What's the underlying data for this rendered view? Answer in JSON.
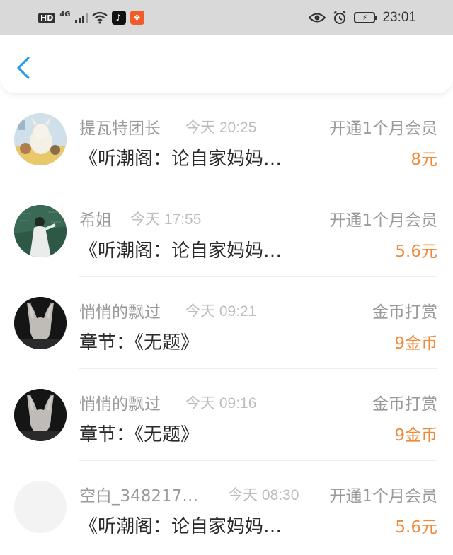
{
  "status_bar": {
    "hd": "HD",
    "network": "4G",
    "time": "23:01",
    "icons": [
      "hd-icon",
      "signal-icon",
      "wifi-icon",
      "tiktok-icon",
      "app-icon",
      "eye-icon",
      "alarm-icon",
      "battery-icon"
    ]
  },
  "nav": {
    "back_icon": "chevron-left-icon",
    "accent": "#2b9ae8"
  },
  "items": [
    {
      "name": "提瓦特团长",
      "time": "今天 20:25",
      "action": "开通1个月会员",
      "title": "《听潮阁：论自家妈妈…",
      "amount": "8元"
    },
    {
      "name": "希姐",
      "time": "今天 17:55",
      "action": "开通1个月会员",
      "title": "《听潮阁：论自家妈妈…",
      "amount": "5.6元"
    },
    {
      "name": "悄悄的飘过",
      "time": "今天 09:21",
      "action": "金币打赏",
      "title": "章节：《无题》",
      "amount": "9金币"
    },
    {
      "name": "悄悄的飘过",
      "time": "今天 09:16",
      "action": "金币打赏",
      "title": "章节：《无题》",
      "amount": "9金币"
    },
    {
      "name": "空白_348217…",
      "time": "今天 08:30",
      "action": "开通1个月会员",
      "title": "《听潮阁：论自家妈妈…",
      "amount": "5.6元"
    }
  ],
  "colors": {
    "amount": "#ef8a3a",
    "meta": "#9a9a9a",
    "time": "#bdbdbd",
    "title": "#2a2a2a"
  }
}
